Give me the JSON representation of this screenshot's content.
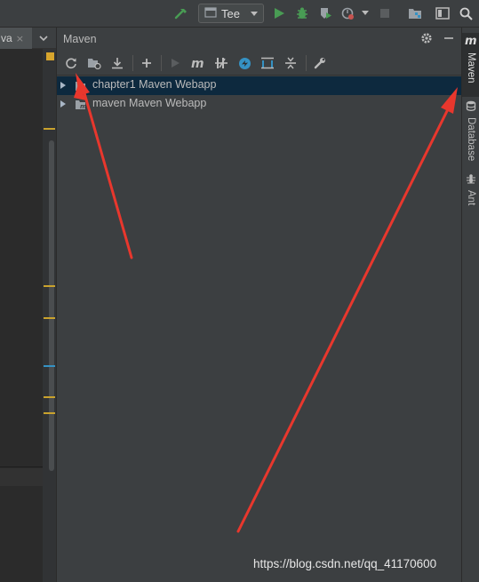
{
  "toolbar": {
    "run_config_label": "Tee",
    "icons": [
      "build-hammer-icon",
      "run-config-icon",
      "run-icon",
      "debug-icon",
      "coverage-icon",
      "profile-icon",
      "stop-icon",
      "project-structure-icon",
      "presentation-icon",
      "search-icon"
    ]
  },
  "editor": {
    "tab_label": "va",
    "tab_close": "×"
  },
  "maven": {
    "title": "Maven",
    "tool_icons": [
      "reload-icon",
      "generate-sources-icon",
      "download-icon",
      "add-icon",
      "run-maven-build-icon",
      "execute-goal-icon",
      "toggle-offline-icon",
      "skip-tests-icon",
      "show-dependencies-icon",
      "collapse-all-icon",
      "settings-wrench-icon"
    ],
    "projects": [
      {
        "label": "chapter1 Maven Webapp",
        "selected": true
      },
      {
        "label": "maven Maven Webapp",
        "selected": false
      }
    ]
  },
  "right_strip": {
    "tabs": [
      {
        "label": "Maven",
        "active": true
      },
      {
        "label": "Database",
        "active": false
      },
      {
        "label": "Ant",
        "active": false
      }
    ]
  },
  "watermark": "https://blog.csdn.net/qq_41170600",
  "colors": {
    "background": "#3c3f41",
    "selection": "#0d293e",
    "arrow_annotation": "#e8372d",
    "run_green": "#4caf50"
  }
}
